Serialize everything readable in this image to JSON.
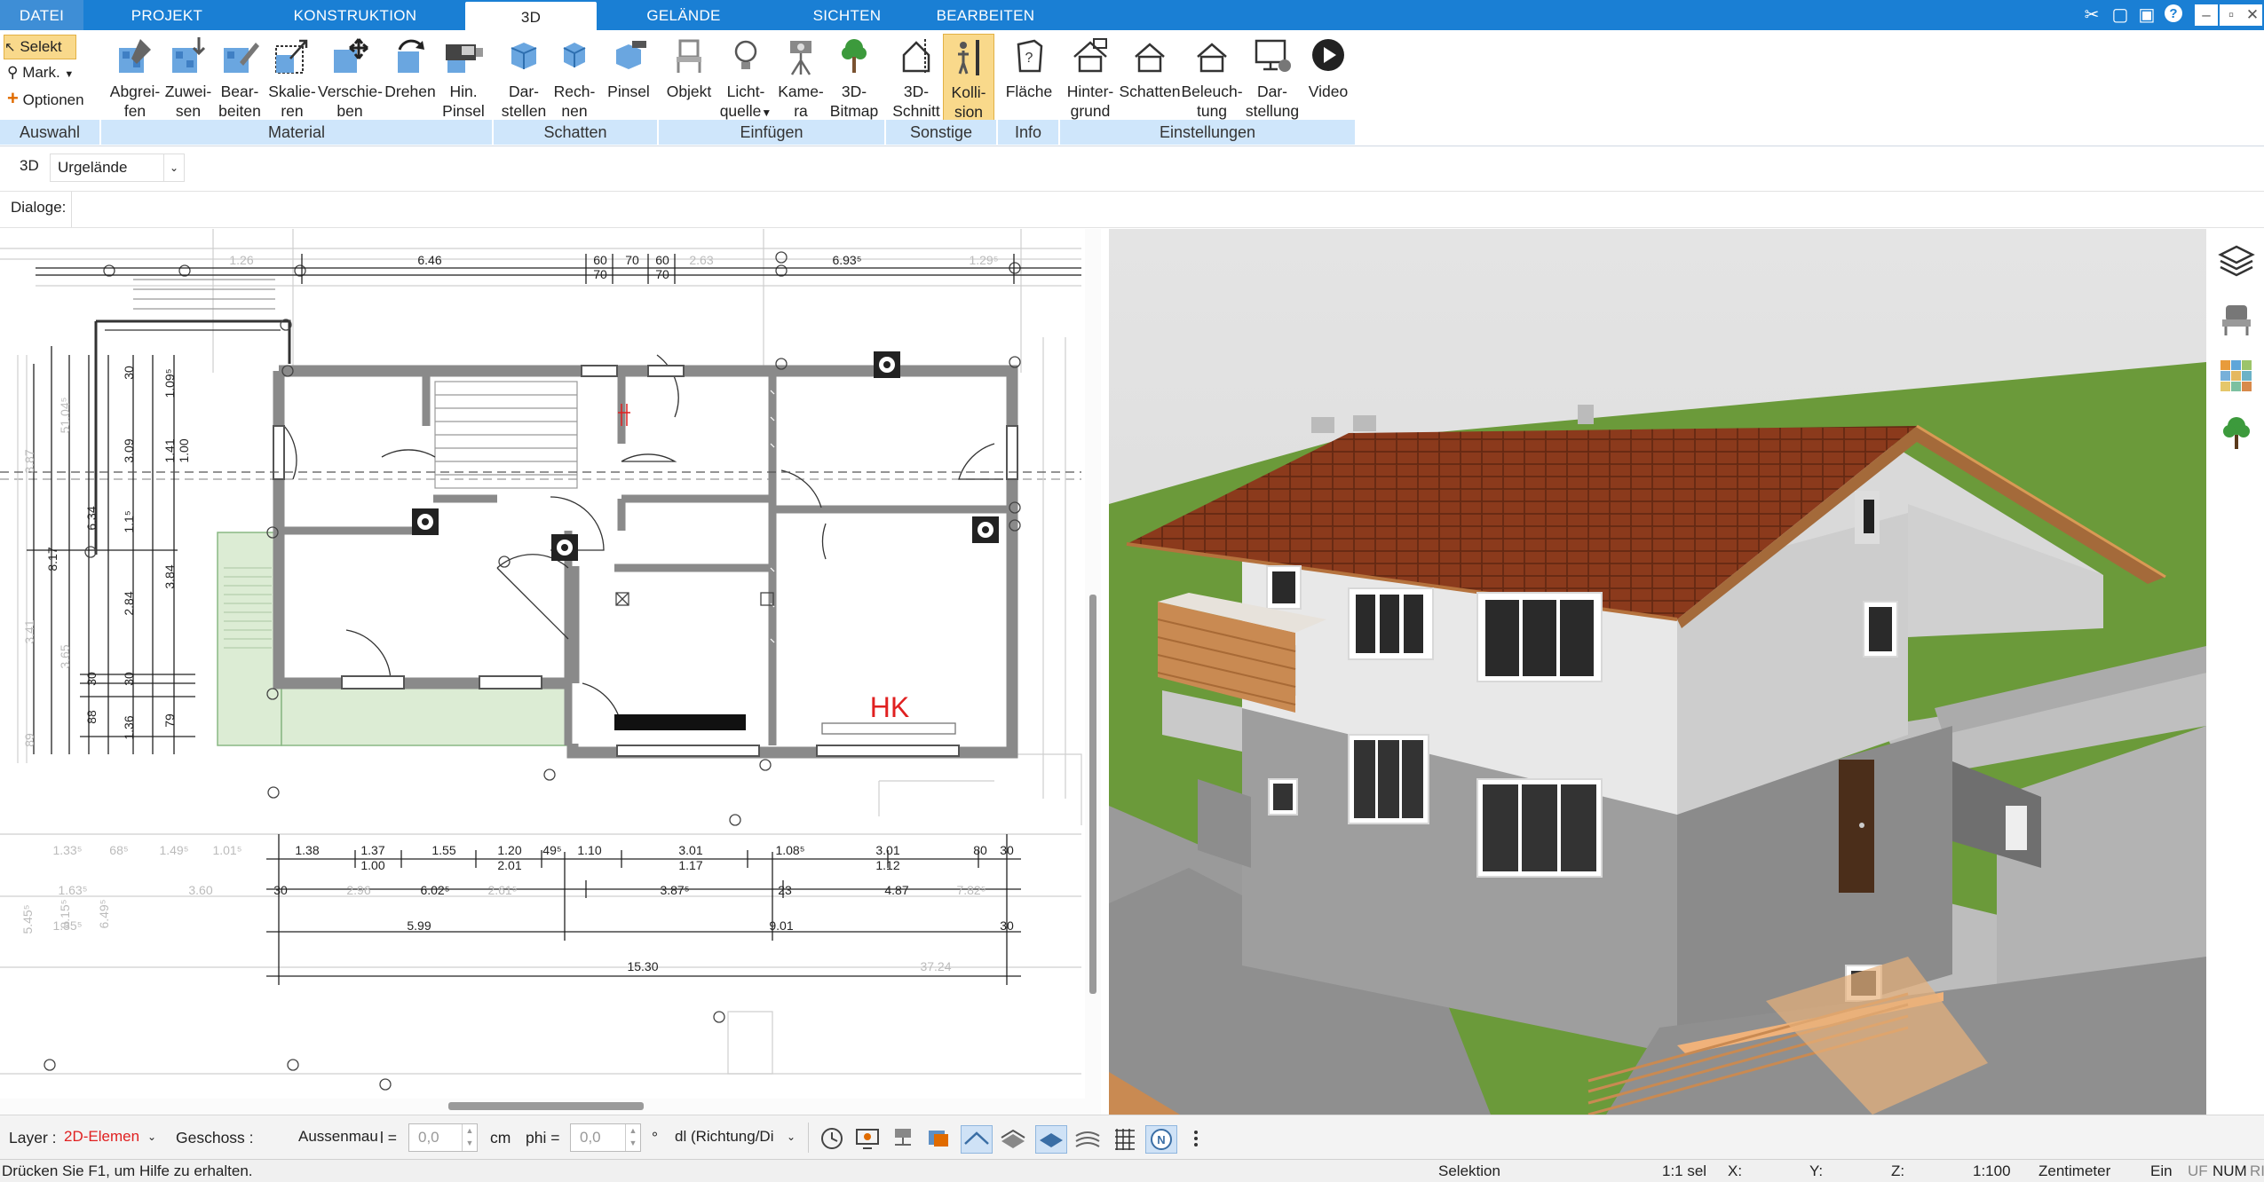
{
  "menu": {
    "tabs": [
      {
        "label": "DATEI"
      },
      {
        "label": "PROJEKT"
      },
      {
        "label": "KONSTRUKTION"
      },
      {
        "label": "3D"
      },
      {
        "label": "GELÄNDE"
      },
      {
        "label": "SICHTEN"
      },
      {
        "label": "BEARBEITEN"
      }
    ],
    "active_tab": "3D"
  },
  "ribbon": {
    "selection": {
      "selekt": "Selekt",
      "mark": "Mark.",
      "optionen": "Optionen"
    },
    "buttons": [
      {
        "l1": "Abgrei-",
        "l2": "fen"
      },
      {
        "l1": "Zuwei-",
        "l2": "sen"
      },
      {
        "l1": "Bear-",
        "l2": "beiten"
      },
      {
        "l1": "Skalie-",
        "l2": "ren"
      },
      {
        "l1": "Verschie-",
        "l2": "ben"
      },
      {
        "l1": "Drehen",
        "l2": ""
      },
      {
        "l1": "Hin.",
        "l2": "Pinsel"
      },
      {
        "l1": "Dar-",
        "l2": "stellen"
      },
      {
        "l1": "Rech-",
        "l2": "nen"
      },
      {
        "l1": "Pinsel",
        "l2": ""
      },
      {
        "l1": "Objekt",
        "l2": ""
      },
      {
        "l1": "Licht-",
        "l2": "quelle"
      },
      {
        "l1": "Kame-",
        "l2": "ra"
      },
      {
        "l1": "3D-",
        "l2": "Bitmap"
      },
      {
        "l1": "3D-",
        "l2": "Schnitt"
      },
      {
        "l1": "Kolli-",
        "l2": "sion"
      },
      {
        "l1": "Fläche",
        "l2": ""
      },
      {
        "l1": "Hinter-",
        "l2": "grund"
      },
      {
        "l1": "Schatten",
        "l2": ""
      },
      {
        "l1": "Beleuch-",
        "l2": "tung"
      },
      {
        "l1": "Dar-",
        "l2": "stellung"
      },
      {
        "l1": "Video",
        "l2": ""
      }
    ],
    "groups": [
      "Auswahl",
      "Material",
      "Schatten",
      "Einfügen",
      "Sonstige",
      "Info",
      "Einstellungen"
    ]
  },
  "view_toolbar": {
    "mode": "3D",
    "terrain": "Urgelände"
  },
  "dialoge_label": "Dialoge:",
  "plan": {
    "room_label": "HK",
    "dims_top": [
      "6.46",
      "60",
      "70",
      "60",
      "70",
      "60",
      "70",
      "6.93⁵",
      "1.26",
      "2.63",
      "1.29⁵"
    ],
    "dims_left": [
      "30",
      "1.09⁵",
      "3.09",
      "1.41",
      "1.00",
      "6.34",
      "8.17",
      "2.84",
      "3.84",
      "30",
      "30",
      "88",
      "1.36",
      "79",
      "51.04⁵",
      "3.87",
      "3.41",
      "3.65",
      "89",
      "1.1⁵"
    ],
    "dims_bottom_row1": [
      "1.33⁵",
      "68⁵",
      "1.49⁵",
      "1.01⁵",
      "1.38",
      "1.37",
      "1.55",
      "1.20",
      "49⁵",
      "1.10",
      "3.01",
      "1.08⁵",
      "3.01",
      "80",
      "30"
    ],
    "dims_bottom_row1b": [
      "1.00",
      "2.01",
      "1.17",
      "1.12"
    ],
    "dims_bottom_row2": [
      "1.63⁵",
      "3.60",
      "30",
      "2.96",
      "6.02⁵",
      "2.61⁵",
      "3.87⁵",
      "23",
      "4.87",
      "7.82⁵"
    ],
    "dims_bottom_row3": [
      "1.35⁵",
      "5.99",
      "9.01",
      "30"
    ],
    "dims_bottom_total": [
      "15.30",
      "37.24"
    ],
    "dims_bottom_left": [
      "5.45⁵",
      "8.15⁵",
      "6.49⁵"
    ]
  },
  "bottom_toolbar": {
    "layer_label": "Layer :",
    "layer_value": "2D-Elemen",
    "geschoss_label": "Geschoss :",
    "geschoss_value": "Aussenmau",
    "l_label": "l =",
    "l_value": "0,0",
    "l_unit": "cm",
    "phi_label": "phi =",
    "phi_value": "0,0",
    "phi_unit": "°",
    "dir_value": "dl (Richtung/Di"
  },
  "status": {
    "hint": "Drücken Sie F1, um Hilfe zu erhalten.",
    "mode": "Selektion",
    "sel": "1:1 sel",
    "x": "X:",
    "y": "Y:",
    "z": "Z:",
    "scale": "1:100",
    "unit": "Zentimeter",
    "ein": "Ein",
    "uf": "UF",
    "num": "NUM",
    "ri": "RI"
  },
  "colors": {
    "menu_bar": "#1a7fd4",
    "group_label": "#cfe6fb",
    "active_button": "#f9d98b",
    "wall": "#8a8a8a",
    "roof": "#8b3a1c",
    "grass": "#6b9a3a",
    "room_label": "#e02020"
  }
}
